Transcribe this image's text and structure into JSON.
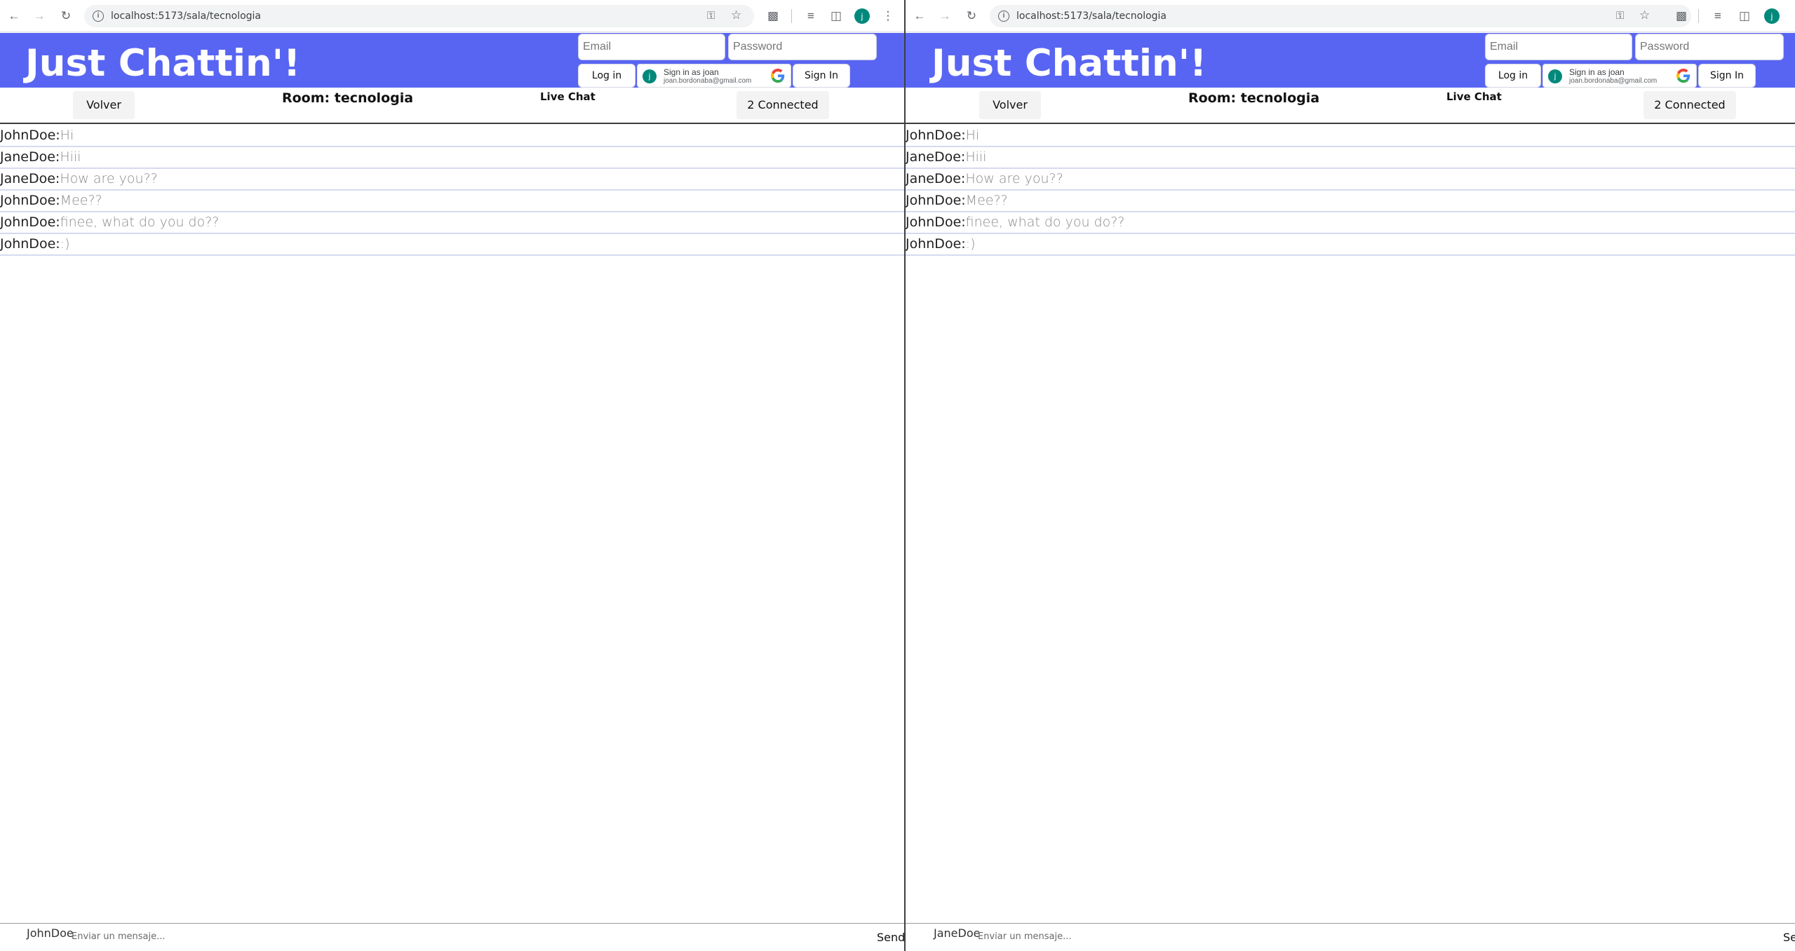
{
  "browser": {
    "url": "localhost:5173/sala/tecnologia",
    "profile_initial": "j",
    "icons": [
      "back-arrow-icon",
      "forward-arrow-icon",
      "reload-icon",
      "site-info-icon",
      "password-key-icon",
      "bookmark-star-icon",
      "extensions-icon",
      "reading-list-icon",
      "side-panel-icon",
      "menu-dots-icon"
    ]
  },
  "app": {
    "title": "Just Chattin'!",
    "email_placeholder": "Email",
    "password_placeholder": "Password",
    "login_label": "Log in",
    "google": {
      "avatar_initial": "j",
      "line1": "Sign in as joan",
      "line2": "joan.bordonaba@gmail.com"
    },
    "signin_label": "Sign In",
    "accent_color": "#5865f2"
  },
  "room": {
    "back_label": "Volver",
    "title": "Room: tecnologia",
    "live_label": "Live Chat",
    "connected_label": "2 Connected"
  },
  "messages": [
    {
      "user": "JohnDoe:",
      "text": "Hi"
    },
    {
      "user": "JaneDoe:",
      "text": "Hiii"
    },
    {
      "user": "JaneDoe:",
      "text": "How are you??"
    },
    {
      "user": "JohnDoe:",
      "text": "Mee??"
    },
    {
      "user": "JohnDoe:",
      "text": "finee, what do you do??"
    },
    {
      "user": "JohnDoe:",
      "text": ":)"
    }
  ],
  "composer": {
    "placeholder": "Enviar un mensaje...",
    "send_label": "Send",
    "send_label_truncated": "Se"
  },
  "windows": [
    {
      "composer_user": "JohnDoe"
    },
    {
      "composer_user": "JaneDoe"
    }
  ]
}
